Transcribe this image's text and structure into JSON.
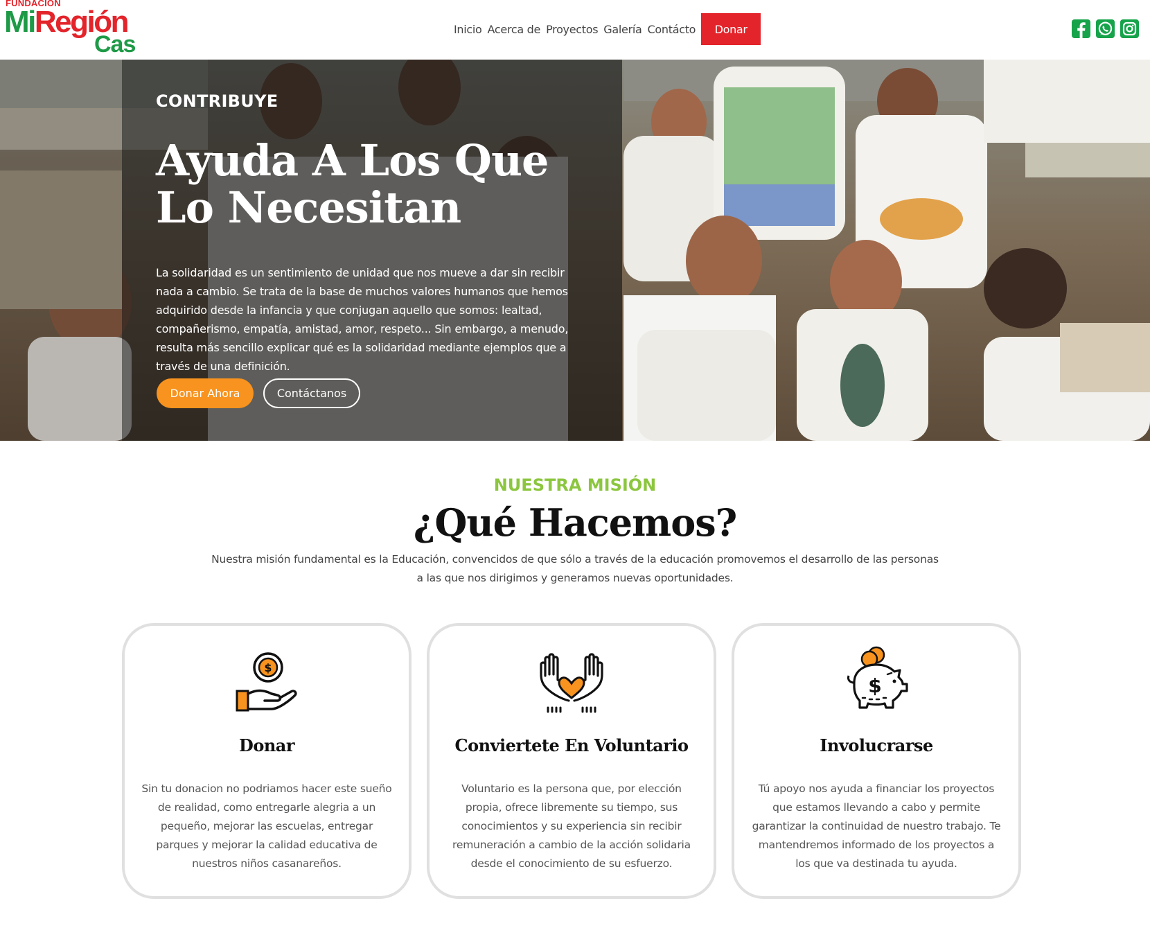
{
  "brand": {
    "logo_top": "FUNDACIÓN",
    "logo_mi": "Mi",
    "logo_region": "Región",
    "logo_cas": "Cas"
  },
  "nav": {
    "items": [
      "Inicio",
      "Acerca de",
      "Proyectos",
      "Galería",
      "Contácto"
    ],
    "donate": "Donar"
  },
  "socials": [
    "facebook-icon",
    "whatsapp-icon",
    "instagram-icon"
  ],
  "colors": {
    "brand_green": "#1e9a47",
    "brand_red": "#e3242b",
    "accent_orange": "#f7931e",
    "mission_green": "#8cc63f"
  },
  "hero": {
    "eyebrow": "CONTRIBUYE",
    "title": "Ayuda A Los Que Lo Necesitan",
    "text": "La solidaridad es un sentimiento de unidad que nos mueve a dar sin recibir nada a cambio. Se trata de la base de muchos valores humanos que hemos adquirido desde la infancia y que conjugan aquello que somos: lealtad, compañerismo, empatía, amistad, amor, respeto... Sin embargo, a menudo, resulta más sencillo explicar qué es la solidaridad mediante ejemplos que a través de una definición.",
    "primary_button": "Donar Ahora",
    "secondary_button": "Contáctanos"
  },
  "mission": {
    "eyebrow": "NUESTRA MISIÓN",
    "title": "¿Qué Hacemos?",
    "text": "Nuestra misión fundamental es la Educación, convencidos de que sólo a través de la educación promovemos el desarrollo de las personas a las que nos dirigimos y generamos nuevas oportunidades."
  },
  "cards": [
    {
      "icon": "coin-hand-icon",
      "title": "Donar",
      "text": "Sin tu donacion no podriamos hacer este sueño de realidad, como entregarle alegria a un pequeño, mejorar las escuelas, entregar parques y mejorar la calidad educativa de nuestros niños casanareños."
    },
    {
      "icon": "heart-hands-icon",
      "title": "Conviertete En Voluntario",
      "text": "Voluntario es la persona que, por elección propia, ofrece libremente su tiempo, sus conocimientos y su experiencia sin recibir remuneración a cambio de la acción solidaria desde el conocimiento de su esfuerzo."
    },
    {
      "icon": "piggy-bank-icon",
      "title": "Involucrarse",
      "text": "Tú apoyo nos ayuda a financiar los proyectos que estamos llevando a cabo y permite garantizar la continuidad de nuestro trabajo. Te mantendremos informado de los proyectos a los que va destinada tu ayuda."
    }
  ]
}
